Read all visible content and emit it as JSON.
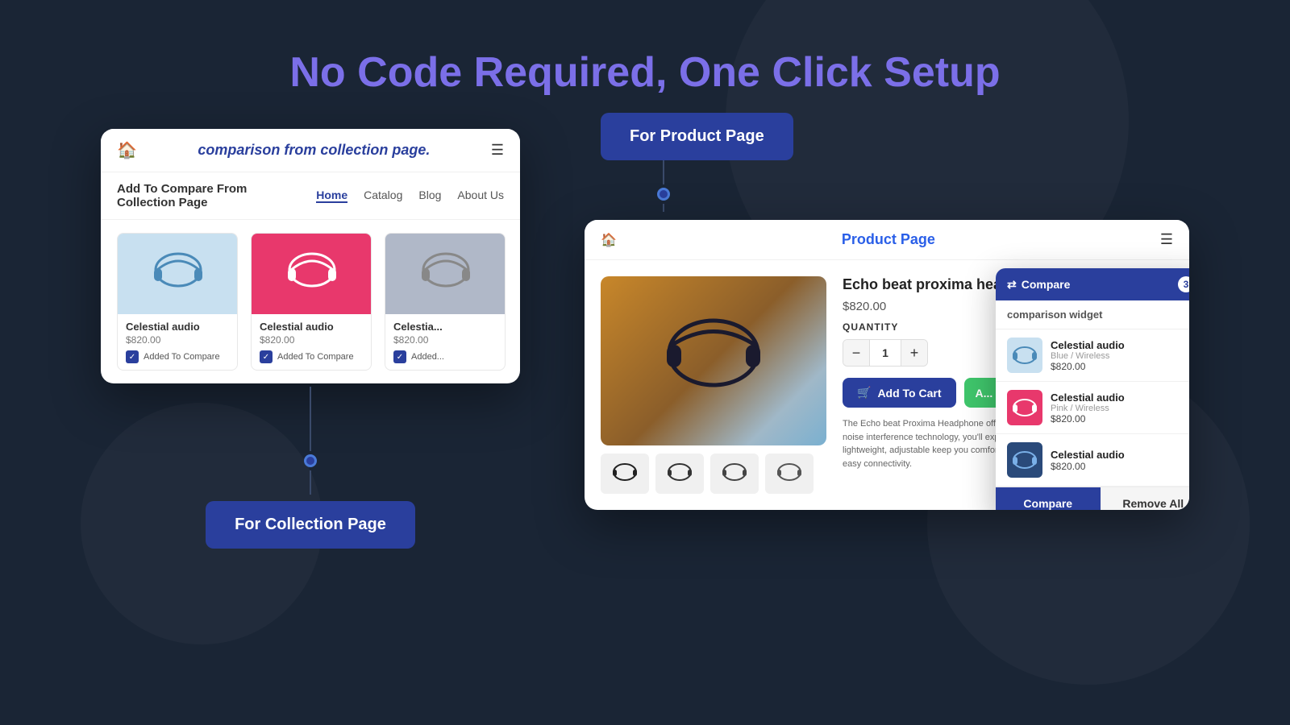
{
  "page": {
    "title_prefix": "No Code Required, One ",
    "title_highlight": "Click Setup"
  },
  "collection_panel": {
    "topbar_title": "comparison from collection page.",
    "nav_title": "Add To Compare From Collection Page",
    "nav_links": [
      "Home",
      "Catalog",
      "Blog",
      "About Us"
    ],
    "active_nav": "Home",
    "products": [
      {
        "name": "Celestial audio",
        "price": "$820.00",
        "compare_text": "Added To Compare",
        "bg": "blue"
      },
      {
        "name": "Celestial audio",
        "price": "$820.00",
        "compare_text": "Added To Compare",
        "bg": "pink"
      },
      {
        "name": "Celestia...",
        "price": "$820.00",
        "compare_text": "Added...",
        "bg": "gray"
      }
    ],
    "cta_label": "For Collection Page"
  },
  "product_panel": {
    "cta_label": "For Product Page",
    "topbar_title": "Product Page",
    "product_name": "Echo beat proxima headph...",
    "product_price": "$820.00",
    "quantity_label": "QUANTITY",
    "quantity_value": "1",
    "add_to_cart_label": "Add To Cart",
    "description": "The Echo beat Proxima Headphone offers superior design. Thanks to its advanced noise interference technology, you'll experience clear sound noise interference. Its lightweight, adjustable keep you comfortable, while its wireless convenience and easy connectivity.",
    "compare_items": [
      {
        "name": "Celestial audio",
        "variant": "Blue / Wireless",
        "price": "$820.00",
        "bg": "blue"
      },
      {
        "name": "Celestial audio",
        "variant": "Pink / Wireless",
        "price": "$820.00",
        "bg": "pink"
      },
      {
        "name": "Celestial audio",
        "variant": "",
        "price": "$820.00",
        "bg": "dark-blue"
      }
    ],
    "widget_title": "comparison widget",
    "compare_btn_label": "Compare",
    "remove_all_label": "Remove All",
    "compare_count": "3"
  }
}
